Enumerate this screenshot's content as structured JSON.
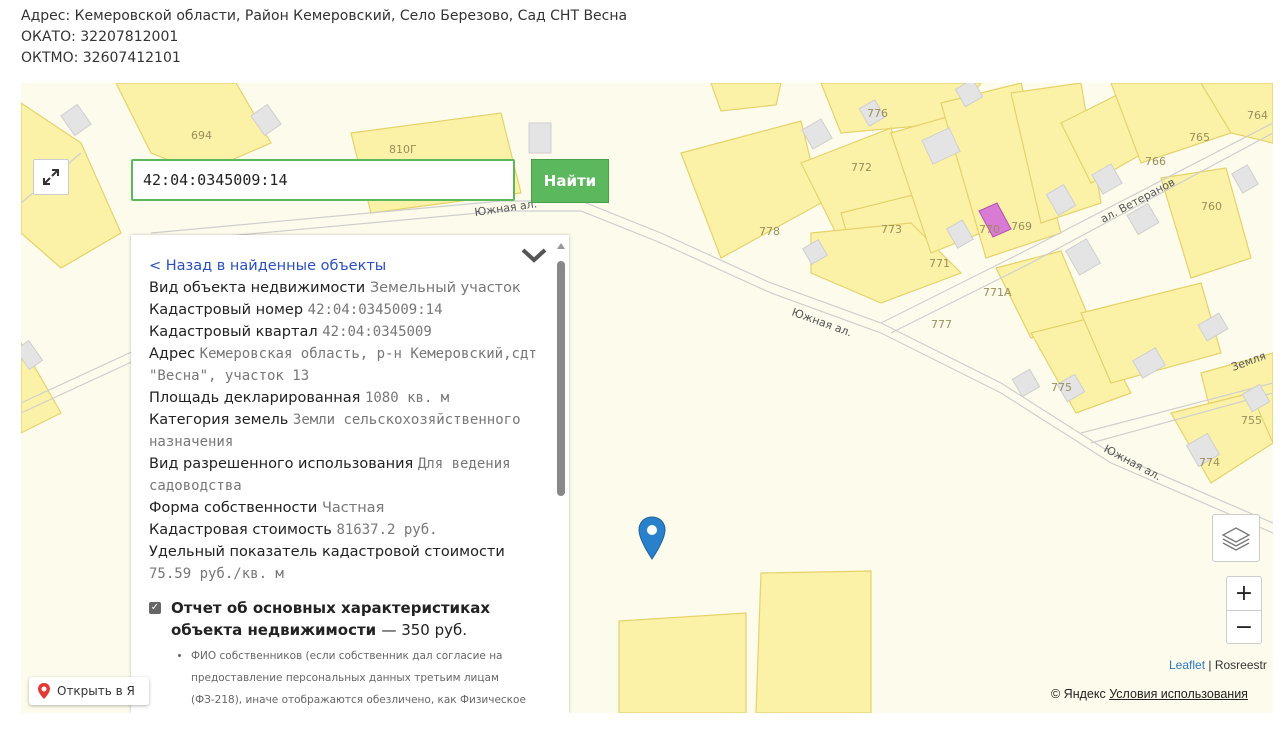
{
  "header": {
    "address": "Адрес: Кемеровской области, Район Кемеровский, Село Березово, Сад СНТ Весна",
    "okato": "ОКАТО: 32207812001",
    "oktmo": "ОКТМО: 32607412101"
  },
  "search": {
    "value": "42:04:0345009:14",
    "button_label": "Найти"
  },
  "panel": {
    "back_link": "< Назад в найденные объекты",
    "fields": [
      {
        "label": "Вид объекта недвижимости",
        "value": "Земельный участок"
      },
      {
        "label": "Кадастровый номер",
        "value": "42:04:0345009:14"
      },
      {
        "label": "Кадастровый квартал",
        "value": "42:04:0345009"
      },
      {
        "label": "Адрес",
        "value": "Кемеровская область, р-н Кемеровский,сдт \"Весна\", участок 13"
      },
      {
        "label": "Площадь декларированная",
        "value": "1080 кв. м"
      },
      {
        "label": "Категория земель",
        "value": "Земли сельскохозяйственного назначения"
      },
      {
        "label": "Вид разрешенного использования",
        "value": "Для ведения садоводства"
      },
      {
        "label": "Форма собственности",
        "value": "Частная"
      },
      {
        "label": "Кадастровая стоимость",
        "value": "81637.2 руб."
      },
      {
        "label": "Удельный показатель кадастровой стоимости",
        "value": "75.59 руб./кв. м"
      }
    ],
    "report": {
      "title": "Отчет об основных характеристиках объекта недвижимости",
      "price": "— 350 руб.",
      "note": "ФИО собственников (если собственник дал согласие на предоставление персональных данных третьим лицам (ФЗ-218), иначе отображаются обезличено, как Физическое лицо)"
    }
  },
  "map": {
    "open_in_yandex": "Открыть в Я",
    "attribution_leaflet": "Leaflet",
    "attribution_sep": " | ",
    "attribution_rosreestr": "Rosreestr",
    "yandex_copy": "© Яндекс",
    "terms": "Условия использования",
    "zoom_in": "+",
    "zoom_out": "−",
    "streets": {
      "yuzhnaya_1": "Южная ал.",
      "yuzhnaya_2": "Южная ал.",
      "yuzhnaya_3": "Южная ал.",
      "veteranov": "ал. Ветеранов",
      "zemlya": "Земля"
    },
    "parcels": {
      "p694": "694",
      "p810g": "810Г",
      "p776": "776",
      "p772": "772",
      "p778": "778",
      "p773": "773",
      "p770": "770",
      "p769": "769",
      "p771": "771",
      "p771a": "771А",
      "p777": "777",
      "p775": "775",
      "p766": "766",
      "p765": "765",
      "p764": "764",
      "p760": "760",
      "p755": "755",
      "p774": "774"
    },
    "colors": {
      "parcel_fill": "#fbf2a8",
      "parcel_stroke": "#e6d26a",
      "building": "#e4e4e4",
      "highlight": "#d97ad4",
      "search_green": "#5cb85c",
      "marker": "#2a81cb"
    }
  }
}
